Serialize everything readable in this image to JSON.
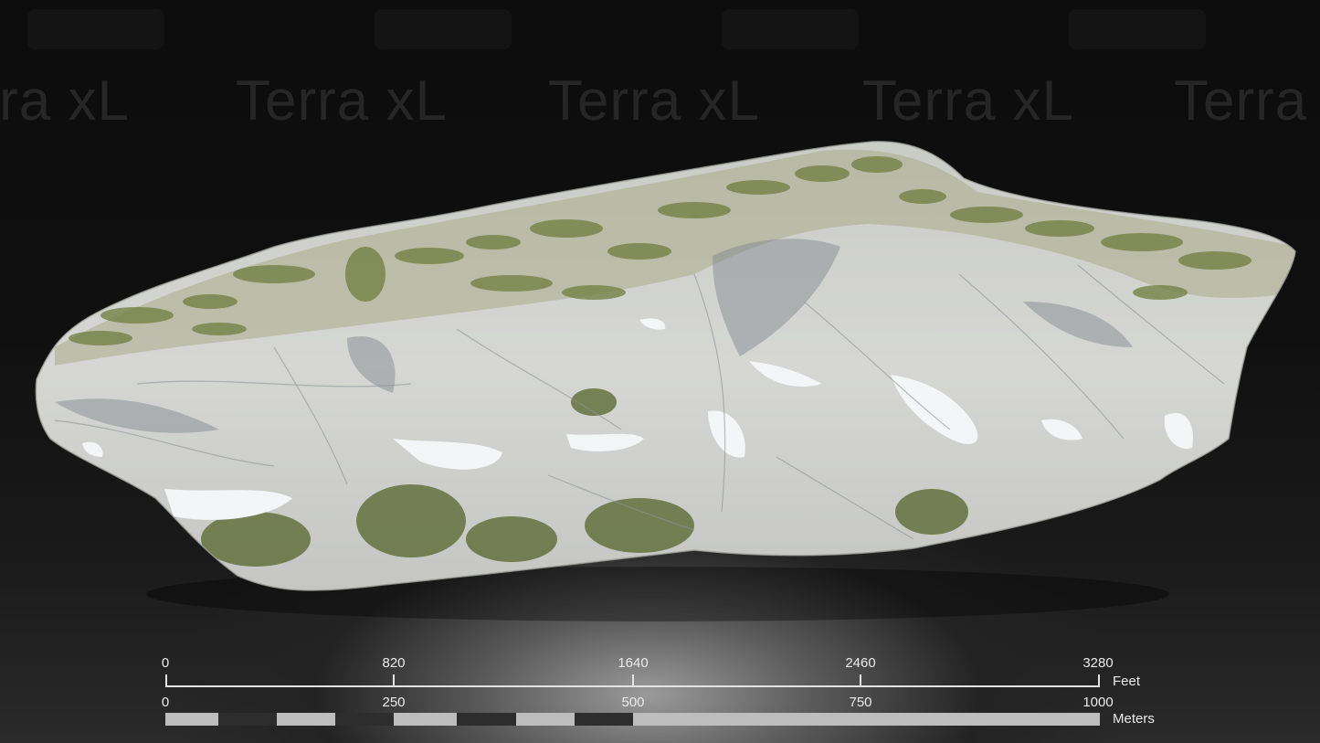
{
  "watermark": {
    "brand": "Terra xL"
  },
  "scale": {
    "feet": {
      "unit": "Feet",
      "ticks": [
        "0",
        "820",
        "1640",
        "2460",
        "3280"
      ]
    },
    "meters": {
      "unit": "Meters",
      "ticks": [
        "0",
        "250",
        "500",
        "750",
        "1000"
      ]
    }
  },
  "colors": {
    "background": "#0b0b0b",
    "rock": "#d2d3d0",
    "vegetation": "#6f7d3e",
    "scale_light": "#bdbdbd",
    "scale_dark": "#2d2d2d"
  }
}
